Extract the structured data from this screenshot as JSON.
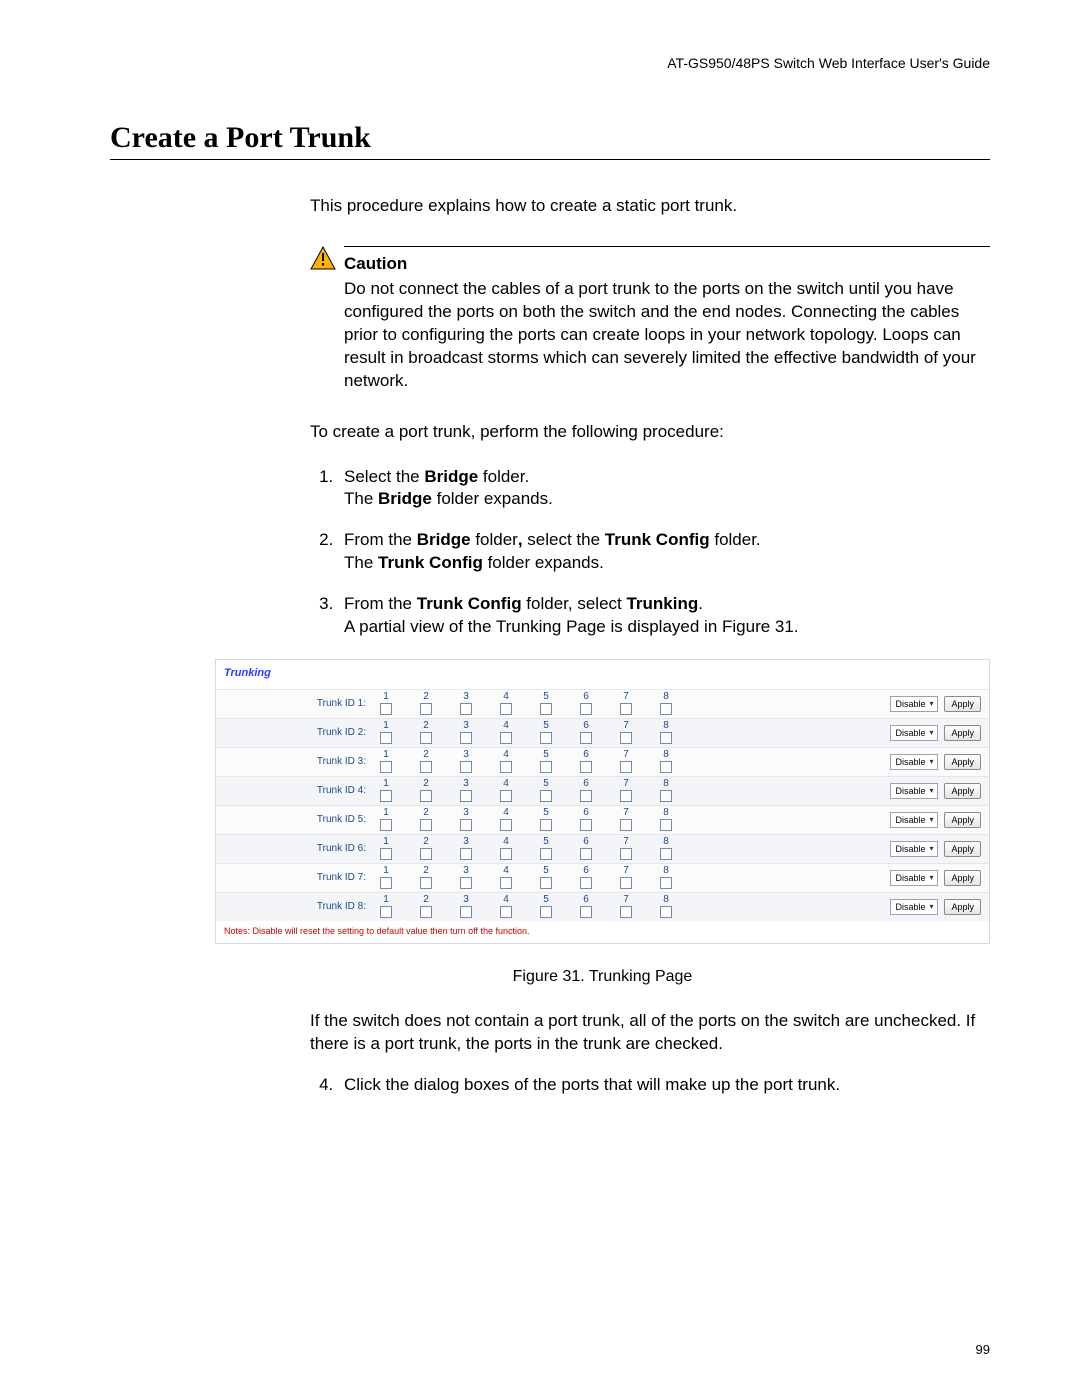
{
  "header": {
    "guide": "AT-GS950/48PS Switch Web Interface User's Guide"
  },
  "title": "Create a Port Trunk",
  "intro": "This procedure explains how to create a static port trunk.",
  "caution": {
    "label": "Caution",
    "text": "Do not connect the cables of a port trunk to the ports on the switch until you have configured the ports on both the switch and the end nodes. Connecting the cables prior to configuring the ports can create loops in your network topology. Loops can result in broadcast storms which can severely limited the effective bandwidth of your network."
  },
  "procedure_intro": "To create a port trunk, perform the following procedure:",
  "steps": {
    "s1a": "Select the ",
    "s1b": "Bridge",
    "s1c": " folder.",
    "s1d": "The ",
    "s1e": "Bridge",
    "s1f": " folder expands.",
    "s2a": "From the ",
    "s2b": "Bridge",
    "s2c": " folder",
    "s2d": ",",
    "s2e": " select the ",
    "s2f": "Trunk Config",
    "s2g": " folder.",
    "s2h": "The ",
    "s2i": "Trunk Config",
    "s2j": " folder expands.",
    "s3a": "From the ",
    "s3b": "Trunk Config",
    "s3c": " folder, select ",
    "s3d": "Trunking",
    "s3e": ".",
    "s3f": "A partial view of the Trunking Page is displayed in Figure 31.",
    "s4": "Click the dialog boxes of the ports that will make up the port trunk."
  },
  "figure": {
    "title": "Trunking",
    "port_numbers": [
      "1",
      "2",
      "3",
      "4",
      "5",
      "6",
      "7",
      "8"
    ],
    "rows": [
      {
        "label": "Trunk ID 1:",
        "status": "Disable",
        "apply": "Apply"
      },
      {
        "label": "Trunk ID 2:",
        "status": "Disable",
        "apply": "Apply"
      },
      {
        "label": "Trunk ID 3:",
        "status": "Disable",
        "apply": "Apply"
      },
      {
        "label": "Trunk ID 4:",
        "status": "Disable",
        "apply": "Apply"
      },
      {
        "label": "Trunk ID 5:",
        "status": "Disable",
        "apply": "Apply"
      },
      {
        "label": "Trunk ID 6:",
        "status": "Disable",
        "apply": "Apply"
      },
      {
        "label": "Trunk ID 7:",
        "status": "Disable",
        "apply": "Apply"
      },
      {
        "label": "Trunk ID 8:",
        "status": "Disable",
        "apply": "Apply"
      }
    ],
    "note": "Notes: Disable will reset the setting to default value then turn off the function.",
    "caption": "Figure 31. Trunking Page"
  },
  "after_figure": {
    "p1": "If the switch does not contain a port trunk, all of the ports on the switch are unchecked. If there is a port trunk, the ports in the trunk are checked."
  },
  "page_number": "99"
}
